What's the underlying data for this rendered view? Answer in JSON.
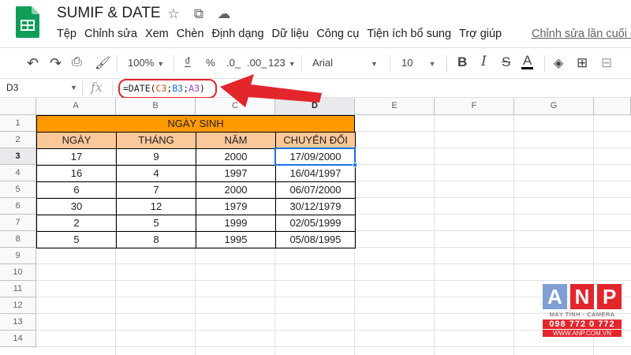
{
  "app": {
    "doc_title": "SUMIF & DATE"
  },
  "menu": {
    "items": [
      "Tệp",
      "Chỉnh sửa",
      "Xem",
      "Chèn",
      "Định dạng",
      "Dữ liệu",
      "Công cụ",
      "Tiện ích bổ sung",
      "Trợ giúp"
    ],
    "last_edit": "Chỉnh sửa lần cuối đ"
  },
  "toolbar": {
    "zoom": "100%",
    "currency": "₫",
    "percent": "%",
    "dec_decrease": ".0_",
    "dec_increase": ".00_",
    "more_formats": "123",
    "font": "Arial",
    "font_size": "10",
    "bold": "B",
    "italic": "I",
    "strike": "S",
    "text_color": "A"
  },
  "formula_bar": {
    "cell_ref": "D3",
    "fx": "fx",
    "formula_prefix": "=DATE(",
    "ref1": "C3",
    "sep1": ";",
    "ref2": "B3",
    "sep2": ";",
    "ref3": "A3",
    "formula_suffix": ")"
  },
  "grid": {
    "columns": [
      "A",
      "B",
      "C",
      "D",
      "E",
      "F",
      "G"
    ],
    "active_column": "D",
    "rows": [
      "1",
      "2",
      "3",
      "4",
      "5",
      "6",
      "7",
      "8",
      "9",
      "10",
      "11",
      "12",
      "13",
      "14"
    ],
    "active_row": "3",
    "banner": "NGÀY SINH",
    "headers": [
      "NGÀY",
      "THÁNG",
      "NĂM",
      "CHUYỂN ĐỔI"
    ],
    "data": [
      [
        "17",
        "9",
        "2000",
        "17/09/2000"
      ],
      [
        "16",
        "4",
        "1997",
        "16/04/1997"
      ],
      [
        "6",
        "7",
        "2000",
        "06/07/2000"
      ],
      [
        "30",
        "12",
        "1979",
        "30/12/1979"
      ],
      [
        "2",
        "5",
        "1999",
        "02/05/1999"
      ],
      [
        "5",
        "8",
        "1995",
        "05/08/1995"
      ]
    ],
    "selected_cell": "D3"
  },
  "watermark": {
    "letters": [
      "A",
      "N",
      "P"
    ],
    "letter_colors": [
      "#7f9fd3",
      "#e3252c",
      "#e3252c"
    ],
    "tagline": "MÁY TÍNH - CAMERA",
    "phone": "098 772 0 772",
    "url": "WWW.ANP.COM.VN"
  },
  "colors": {
    "banner_fill": "#ff9900",
    "header_fill": "#fbc899",
    "selection": "#1a73e8",
    "annotation": "#e3252c"
  }
}
